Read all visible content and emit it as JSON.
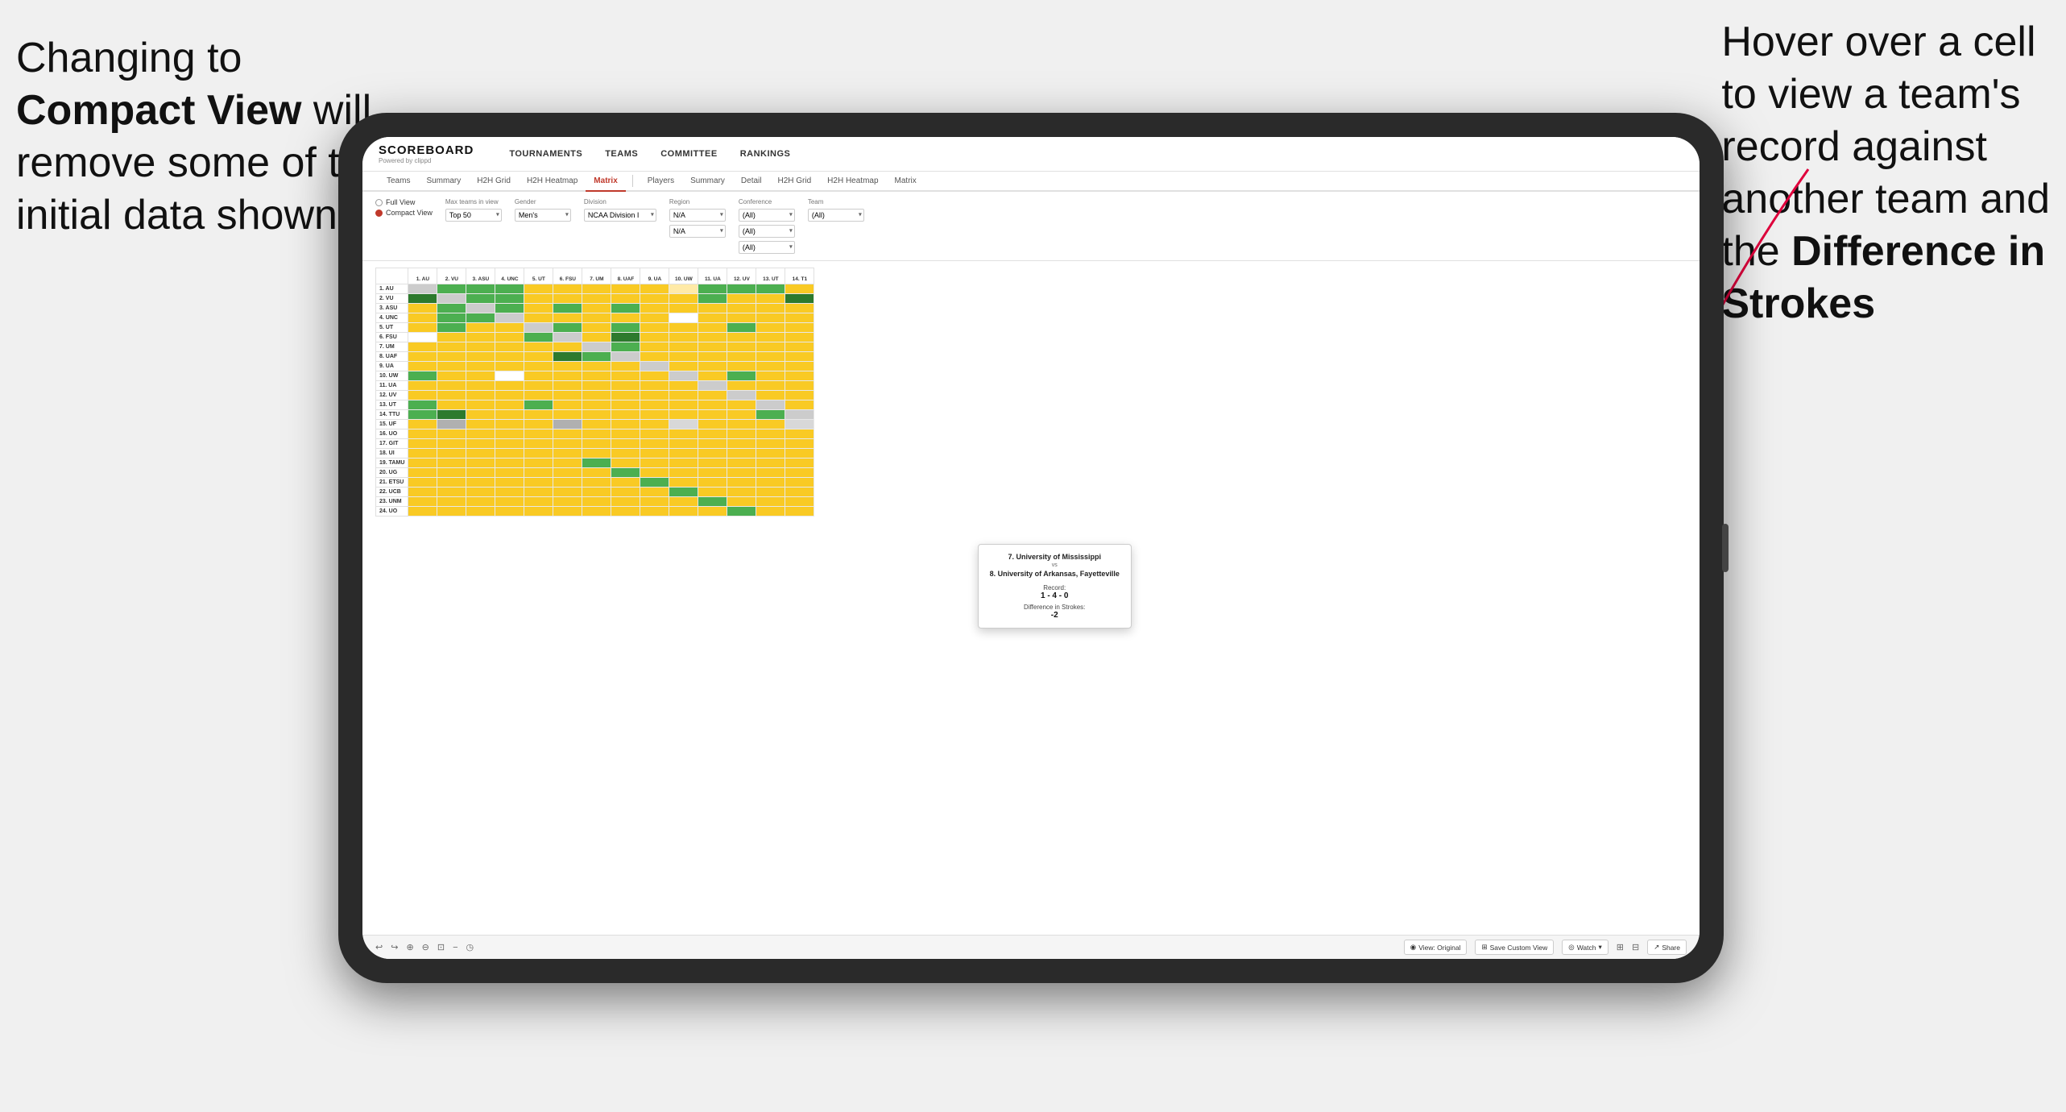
{
  "annotation_left": {
    "line1": "Changing to",
    "bold": "Compact View",
    "line2": " will",
    "line3": "remove some of the",
    "line4": "initial data shown"
  },
  "annotation_right": {
    "line1": "Hover over a cell",
    "line2": "to view a team's",
    "line3": "record against",
    "line4": "another team and",
    "line5_plain": "the ",
    "bold": "Difference in",
    "line6": "Strokes"
  },
  "nav": {
    "logo": "SCOREBOARD",
    "logo_sub": "Powered by clippd",
    "items": [
      "TOURNAMENTS",
      "TEAMS",
      "COMMITTEE",
      "RANKINGS"
    ]
  },
  "sub_tabs_left": [
    "Teams",
    "Summary",
    "H2H Grid",
    "H2H Heatmap",
    "Matrix"
  ],
  "sub_tabs_right": [
    "Players",
    "Summary",
    "Detail",
    "H2H Grid",
    "H2H Heatmap",
    "Matrix"
  ],
  "active_tab": "Matrix",
  "filters": {
    "view_options": [
      "Full View",
      "Compact View"
    ],
    "selected_view": "Compact View",
    "max_teams_label": "Max teams in view",
    "max_teams_value": "Top 50",
    "gender_label": "Gender",
    "gender_value": "Men's",
    "division_label": "Division",
    "division_value": "NCAA Division I",
    "region_label": "Region",
    "region_values": [
      "N/A",
      "N/A"
    ],
    "conference_label": "Conference",
    "conference_values": [
      "(All)",
      "(All)",
      "(All)"
    ],
    "team_label": "Team",
    "team_value": "(All)"
  },
  "col_headers": [
    "1. AU",
    "2. VU",
    "3. ASU",
    "4. UNC",
    "5. UT",
    "6. FSU",
    "7. UM",
    "8. UAF",
    "9. UA",
    "10. UW",
    "11. UA",
    "12. UV",
    "13. UT",
    "14. T1"
  ],
  "row_headers": [
    "1. AU",
    "2. VU",
    "3. ASU",
    "4. UNC",
    "5. UT",
    "6. FSU",
    "7. UM",
    "8. UAF",
    "9. UA",
    "10. UW",
    "11. UA",
    "12. UV",
    "13. UT",
    "14. TTU",
    "15. UF",
    "16. UO",
    "17. GIT",
    "18. UI",
    "19. TAMU",
    "20. UG",
    "21. ETSU",
    "22. UCB",
    "23. UNM",
    "24. UO"
  ],
  "tooltip": {
    "team1": "7. University of Mississippi",
    "vs": "vs",
    "team2": "8. University of Arkansas, Fayetteville",
    "record_label": "Record:",
    "record_value": "1 - 4 - 0",
    "diff_label": "Difference in Strokes:",
    "diff_value": "-2"
  },
  "toolbar": {
    "view_original": "View: Original",
    "save_custom": "Save Custom View",
    "watch": "Watch",
    "share": "Share"
  }
}
